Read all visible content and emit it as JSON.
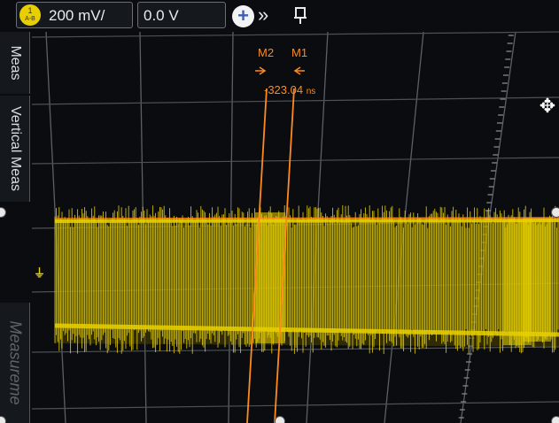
{
  "toolbar": {
    "channel_badge": "1",
    "channel_badge_sub": "A-B",
    "vertical_scale": "200 mV/",
    "offset": "0.0 V",
    "plus_icon": "plus-icon",
    "chevron_icon": "double-chevron-right-icon",
    "pin_icon": "pin-icon"
  },
  "side_tabs": {
    "partial_top": "Meas",
    "vertical_meas": "Vertical Meas",
    "measurements": "Measureme"
  },
  "cursors": {
    "m2_label": "M2",
    "m1_label": "M1",
    "delta_value": "-323.04",
    "delta_unit": "ns",
    "color": "#ff8a1c"
  },
  "waveform": {
    "color": "#e8d000",
    "ground_marker_icon": "ground-reference-icon"
  },
  "screen": {
    "move_icon": "move-crosshair-icon"
  }
}
